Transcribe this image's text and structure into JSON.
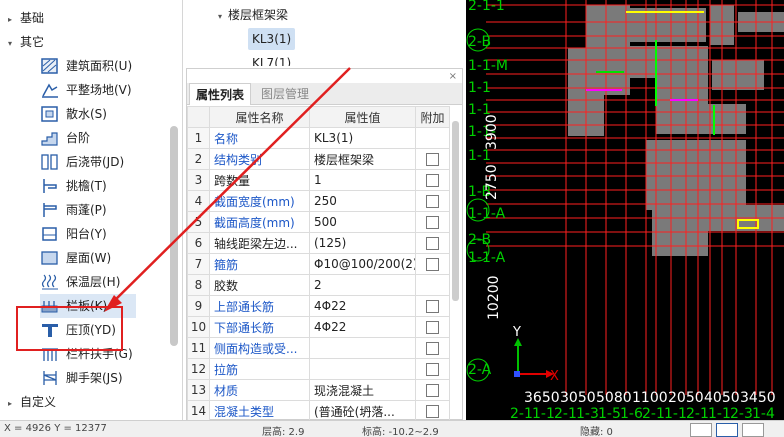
{
  "tree": {
    "groups": [
      {
        "label": "基础",
        "expanded": false
      },
      {
        "label": "其它",
        "expanded": true
      },
      {
        "label": "自定义",
        "expanded": false
      }
    ],
    "items": [
      {
        "label": "建筑面积(U)",
        "icon": "building-area-icon"
      },
      {
        "label": "平整场地(V)",
        "icon": "site-leveling-icon"
      },
      {
        "label": "散水(S)",
        "icon": "apron-icon"
      },
      {
        "label": "台阶",
        "icon": "steps-icon"
      },
      {
        "label": "后浇带(JD)",
        "icon": "post-cast-strip-icon"
      },
      {
        "label": "挑檐(T)",
        "icon": "cornice-icon"
      },
      {
        "label": "雨蓬(P)",
        "icon": "canopy-icon"
      },
      {
        "label": "阳台(Y)",
        "icon": "balcony-icon"
      },
      {
        "label": "屋面(W)",
        "icon": "roof-icon"
      },
      {
        "label": "保温层(H)",
        "icon": "insulation-icon"
      },
      {
        "label": "栏板(K)",
        "icon": "parapet-icon"
      },
      {
        "label": "压顶(YD)",
        "icon": "coping-icon"
      },
      {
        "label": "栏杆扶手(G)",
        "icon": "railing-icon"
      },
      {
        "label": "脚手架(JS)",
        "icon": "scaffold-icon"
      }
    ]
  },
  "floor_tree": {
    "node": "楼层框架梁",
    "children": [
      "KL3(1)",
      "KL7(1)"
    ]
  },
  "attr_panel": {
    "close": "×",
    "tabs": [
      "属性列表",
      "图层管理"
    ],
    "columns": [
      "",
      "属性名称",
      "属性值",
      "附加"
    ],
    "rows": [
      {
        "n": "1",
        "name": "名称",
        "value": "KL3(1)",
        "blue": true,
        "check": false
      },
      {
        "n": "2",
        "name": "结构类别",
        "value": "楼层框架梁",
        "blue": true,
        "check": true
      },
      {
        "n": "3",
        "name": "跨数量",
        "value": "1",
        "blue": false,
        "check": true
      },
      {
        "n": "4",
        "name": "截面宽度(mm)",
        "value": "250",
        "blue": true,
        "check": true
      },
      {
        "n": "5",
        "name": "截面高度(mm)",
        "value": "500",
        "blue": true,
        "check": true
      },
      {
        "n": "6",
        "name": "轴线距梁左边...",
        "value": "(125)",
        "blue": false,
        "check": true
      },
      {
        "n": "7",
        "name": "箍筋",
        "value": "Φ10@100/200(2)",
        "blue": true,
        "check": true
      },
      {
        "n": "8",
        "name": "胶数",
        "value": "2",
        "blue": false,
        "check": false
      },
      {
        "n": "9",
        "name": "上部通长筋",
        "value": "4Φ22",
        "blue": true,
        "check": true
      },
      {
        "n": "10",
        "name": "下部通长筋",
        "value": "4Φ22",
        "blue": true,
        "check": true
      },
      {
        "n": "11",
        "name": "侧面构造或受...",
        "value": "",
        "blue": true,
        "check": true
      },
      {
        "n": "12",
        "name": "拉筋",
        "value": "",
        "blue": true,
        "check": true
      },
      {
        "n": "13",
        "name": "材质",
        "value": "现浇混凝土",
        "blue": true,
        "check": true
      },
      {
        "n": "14",
        "name": "混凝土类型",
        "value": "(普通砼(坍落...",
        "blue": true,
        "check": true
      }
    ]
  },
  "viewport": {
    "axis_labels_left": [
      "2-1-1",
      "2-B",
      "1-1-M",
      "1-1",
      "1-1",
      "1-1-",
      "1-1",
      "1-B",
      "1-1-A",
      "2-B",
      "1-1-A",
      "2-A"
    ],
    "dimension_vertical": [
      "3900",
      "2750",
      "10200"
    ],
    "dimension_bottom": [
      "3650",
      "3050",
      "5080",
      "1100",
      "2050",
      "4050",
      "3450"
    ],
    "axis_labels_bottom": [
      "2-1",
      "1-1",
      "2-1",
      "1-3",
      "1-5",
      "1-6",
      "2-1",
      "1-1",
      "2-1",
      "1-1",
      "2-3",
      "1-4"
    ],
    "ucs_x": "X",
    "ucs_y": "Y"
  },
  "statusbar": {
    "left": "X = 4926 Y = 12377",
    "mid1": "层高: 2.9",
    "mid2": "标高: -10.2~2.9",
    "right": "隐藏: 0"
  },
  "colors": {
    "selected_bg": "#dbe7f5",
    "highlight_red": "#e02020",
    "grid_red": "#ff2020",
    "slab_gray": "#7a7a7a",
    "axis_green": "#00d000"
  }
}
